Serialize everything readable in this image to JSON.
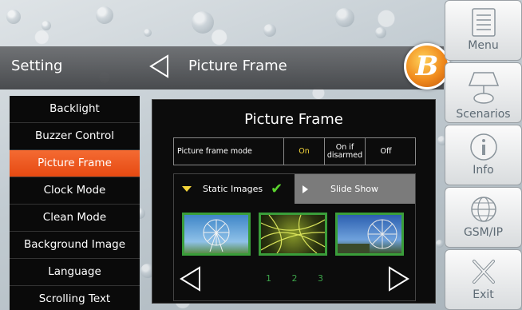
{
  "header": {
    "setting_title": "Setting",
    "screen_title": "Picture Frame"
  },
  "left_menu": {
    "items": [
      {
        "label": "Backlight",
        "active": false
      },
      {
        "label": "Buzzer Control",
        "active": false
      },
      {
        "label": "Picture Frame",
        "active": true
      },
      {
        "label": "Clock Mode",
        "active": false
      },
      {
        "label": "Clean Mode",
        "active": false
      },
      {
        "label": "Background Image",
        "active": false
      },
      {
        "label": "Language",
        "active": false
      },
      {
        "label": "Scrolling Text",
        "active": false
      }
    ]
  },
  "panel": {
    "title": "Picture Frame",
    "mode_label": "Picture frame mode",
    "options": [
      {
        "label": "On",
        "selected": true
      },
      {
        "label": "On if disarmed",
        "selected": false
      },
      {
        "label": "Off",
        "selected": false
      }
    ],
    "tabs": {
      "static": "Static Images",
      "slide": "Slide Show"
    },
    "pages": [
      "1",
      "2",
      "3"
    ]
  },
  "sidebar": {
    "menu": "Menu",
    "scenarios": "Scenarios",
    "info": "Info",
    "gsm": "GSM/IP",
    "exit": "Exit"
  },
  "colors": {
    "accent_orange": "#e64a12",
    "check_green": "#5bd42e",
    "on_yellow": "#f5d63a"
  }
}
